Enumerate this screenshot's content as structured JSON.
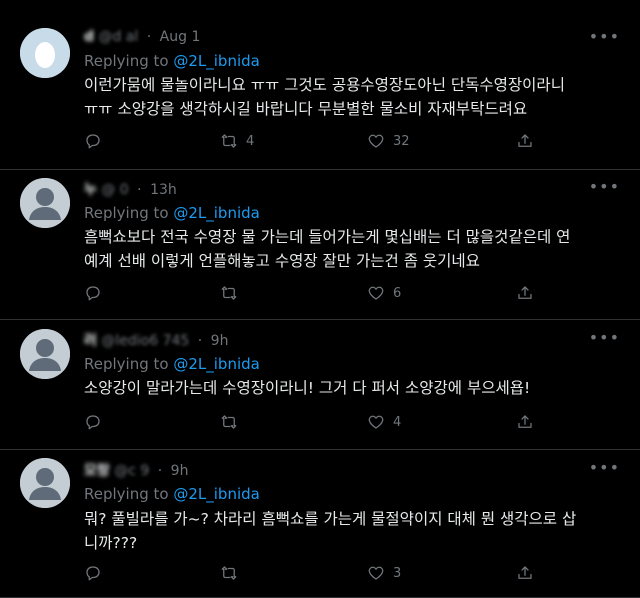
{
  "tweets": [
    {
      "display_name": "d",
      "handle": "@d",
      "handle_tail": "al",
      "time": "Aug 1",
      "replying_prefix": "Replying to",
      "replying_to": "@2L_ibnida",
      "text_lines": [
        "이런가뭄에 물놀이라니요 ㅠㅠ 그것도 공용수영장도아닌 단독수영장이라니",
        "ㅠㅠ 소양강을 생각하시길 바랍니다 무분별한 물소비 자재부탁드려요"
      ],
      "reply_count": "",
      "retweet_count": "4",
      "like_count": "32",
      "avatar": "egg"
    },
    {
      "display_name": "누",
      "handle": "@",
      "handle_tail": "0",
      "time": "13h",
      "replying_prefix": "Replying to",
      "replying_to": "@2L_ibnida",
      "text_lines": [
        "흠뻑쇼보다 전국 수영장 물 가는데 들어가는게 몇십배는 더 많을것같은데 연",
        "예계 선배 이렇게 언플해놓고 수영장 잘만 가는건 좀 웃기네요"
      ],
      "reply_count": "",
      "retweet_count": "",
      "like_count": "6",
      "avatar": "default"
    },
    {
      "display_name": "러",
      "handle": "@ledio6",
      "handle_tail": "745",
      "time": "9h",
      "replying_prefix": "Replying to",
      "replying_to": "@2L_ibnida",
      "text_lines": [
        "소양강이 말라가는데 수영장이라니! 그거 다 퍼서 소양강에 부으세욥!"
      ],
      "reply_count": "",
      "retweet_count": "",
      "like_count": "4",
      "avatar": "default"
    },
    {
      "display_name": "모랑",
      "handle": "@c",
      "handle_tail": "9",
      "time": "9h",
      "replying_prefix": "Replying to",
      "replying_to": "@2L_ibnida",
      "text_lines": [
        "뭐? 풀빌라를 가~? 차라리 흠뻑쇼를 가는게 물절약이지 대체 뭔 생각으로 삽",
        "니까???"
      ],
      "reply_count": "",
      "retweet_count": "",
      "like_count": "3",
      "avatar": "default"
    }
  ]
}
